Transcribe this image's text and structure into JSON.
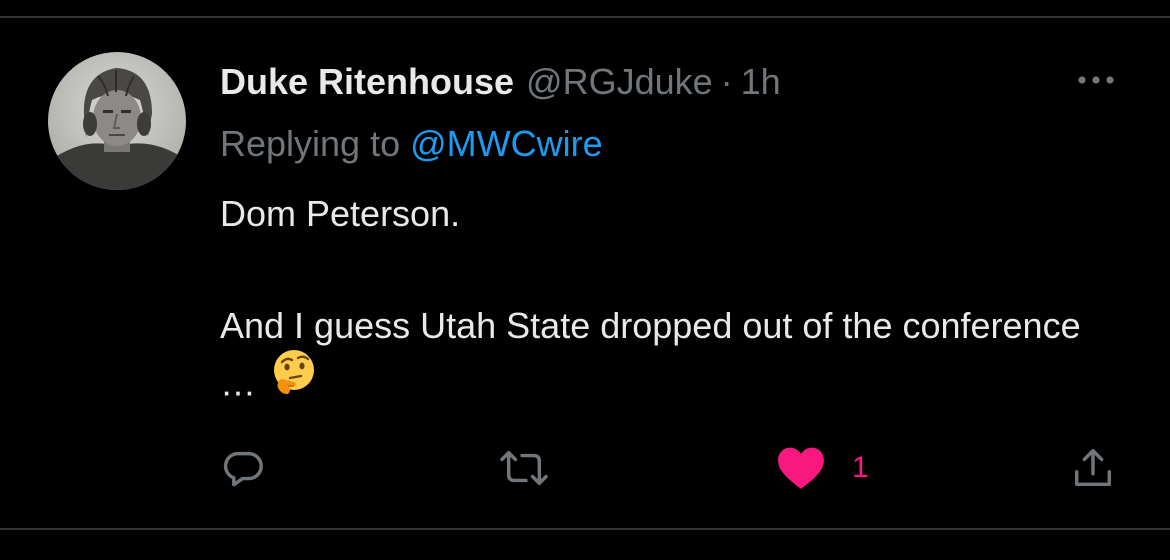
{
  "tweet": {
    "author": {
      "display_name": "Duke Ritenhouse",
      "handle": "@RGJduke",
      "avatar": "vintage-football-player-photo"
    },
    "separator": "·",
    "time": "1h",
    "reply_prefix": "Replying to",
    "reply_mention": "@MWCwire",
    "body": {
      "line1": "Dom Peterson.",
      "line2": "And I guess Utah State dropped out of the conference …",
      "emoji": "thinking-face"
    },
    "actions": {
      "reply_icon": "comment-bubble-icon",
      "retweet_icon": "retweet-icon",
      "like_icon": "heart-filled-icon",
      "like_count": "1",
      "share_icon": "share-upload-icon"
    },
    "more_icon": "ellipsis-icon"
  },
  "colors": {
    "background": "#000000",
    "primary_text": "#e7e9ea",
    "secondary_text": "#71767b",
    "link": "#1d9bf0",
    "like": "#f91880",
    "divider": "#2f3336"
  }
}
